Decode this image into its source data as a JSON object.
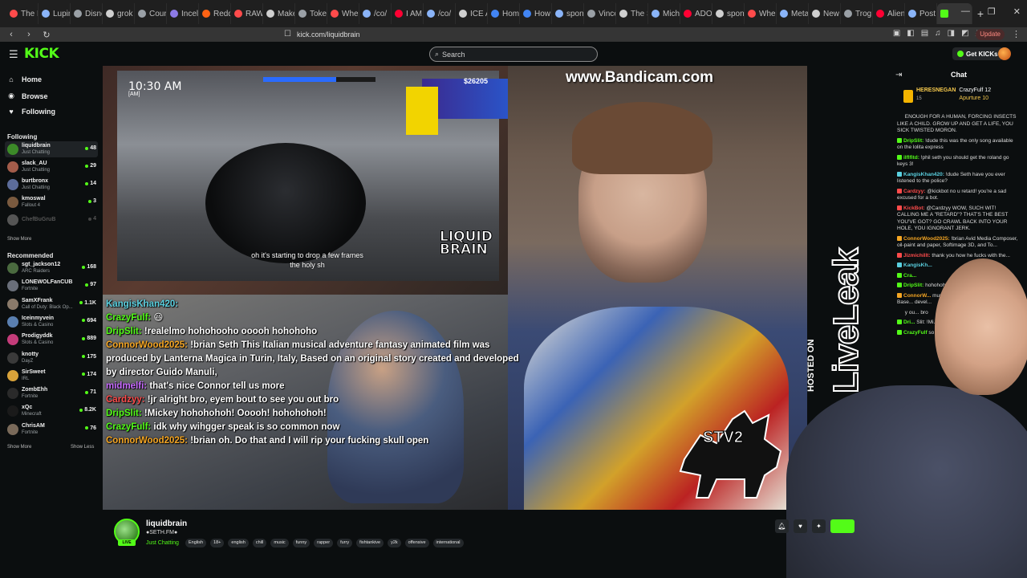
{
  "browser": {
    "tabs": [
      {
        "label": "The F",
        "color": "#ff4b4b"
      },
      {
        "label": "Lupin",
        "color": "#8ab4f8"
      },
      {
        "label": "Disne",
        "color": "#9aa0a6"
      },
      {
        "label": "grok",
        "color": "#cfcfcf"
      },
      {
        "label": "Coun",
        "color": "#9aa0a6"
      },
      {
        "label": "Incel",
        "color": "#8c7ae6"
      },
      {
        "label": "Reddi",
        "color": "#ff6314"
      },
      {
        "label": "RAW",
        "color": "#ff4b4b"
      },
      {
        "label": "Make",
        "color": "#cfcfcf"
      },
      {
        "label": "Toke",
        "color": "#9aa0a6"
      },
      {
        "label": "Whe",
        "color": "#ff4b4b"
      },
      {
        "label": "/co/",
        "color": "#8ab4f8"
      },
      {
        "label": "I AM",
        "color": "#ff0033"
      },
      {
        "label": "/co/",
        "color": "#8ab4f8"
      },
      {
        "label": "ICE A",
        "color": "#cfcfcf"
      },
      {
        "label": "Hom",
        "color": "#4285f4"
      },
      {
        "label": "How",
        "color": "#4285f4"
      },
      {
        "label": "spon",
        "color": "#8ab4f8"
      },
      {
        "label": "Vince",
        "color": "#9aa0a6"
      },
      {
        "label": "The S",
        "color": "#cfcfcf"
      },
      {
        "label": "Mich",
        "color": "#8ab4f8"
      },
      {
        "label": "ADOI",
        "color": "#ff0033"
      },
      {
        "label": "spon",
        "color": "#cfcfcf"
      },
      {
        "label": "Whe",
        "color": "#ff4b4b"
      },
      {
        "label": "Meta",
        "color": "#8ab4f8"
      },
      {
        "label": "New",
        "color": "#cfcfcf"
      },
      {
        "label": "Trog",
        "color": "#9aa0a6"
      },
      {
        "label": "Alien",
        "color": "#ff0033"
      },
      {
        "label": "Post",
        "color": "#8ab4f8"
      }
    ],
    "active_tab_color": "#53fc18",
    "url": "kick.com/liquidbrain",
    "update_label": "Update"
  },
  "header": {
    "logo": "KICK",
    "search_placeholder": "Search",
    "get_kicks_label": "Get KICKs"
  },
  "sidebar": {
    "nav": [
      {
        "label": "Home",
        "icon": "home-icon",
        "glyph": "⌂"
      },
      {
        "label": "Browse",
        "icon": "compass-icon",
        "glyph": "◉"
      },
      {
        "label": "Following",
        "icon": "heart-icon",
        "glyph": "♥"
      }
    ],
    "following_title": "Following",
    "following": [
      {
        "name": "liquidbrain",
        "category": "Just Chatting",
        "viewers": "48",
        "color": "#3c8a28"
      },
      {
        "name": "slack_AU",
        "category": "Just Chatting",
        "viewers": "29",
        "color": "#a35c4a"
      },
      {
        "name": "burtbronx",
        "category": "Just Chatting",
        "viewers": "14",
        "color": "#5c6c9a"
      },
      {
        "name": "kmoswal",
        "category": "Fallout 4",
        "viewers": "3",
        "color": "#7a5a3f"
      },
      {
        "name": "ChefBuGruB",
        "category": "",
        "viewers": "4",
        "color": "#555555",
        "offline": true
      }
    ],
    "show_more_label": "Show More",
    "recommended_title": "Recommended",
    "recommended": [
      {
        "name": "sgt_jackson12",
        "category": "ARC Raiders",
        "viewers": "168",
        "color": "#4a6a3f"
      },
      {
        "name": "LONEWOLFanCUB",
        "category": "Fortnite",
        "viewers": "97",
        "color": "#6a6f7a"
      },
      {
        "name": "SamXFrank",
        "category": "Call of Duty: Black Op...",
        "viewers": "1.1K",
        "color": "#8a7a6a"
      },
      {
        "name": "Iceinmyvein",
        "category": "Slots & Casino",
        "viewers": "694",
        "color": "#5a7fb0"
      },
      {
        "name": "Prodigyddk",
        "category": "Slots & Casino",
        "viewers": "889",
        "color": "#c43c7a"
      },
      {
        "name": "knotty",
        "category": "DayZ",
        "viewers": "175",
        "color": "#3a3a3a"
      },
      {
        "name": "SirSweet",
        "category": "IRL",
        "viewers": "174",
        "color": "#d8a23a"
      },
      {
        "name": "ZombEhh",
        "category": "Fortnite",
        "viewers": "71",
        "color": "#2a2a2a"
      },
      {
        "name": "xQc",
        "category": "Minecraft",
        "viewers": "8.2K",
        "color": "#1a1a1a"
      },
      {
        "name": "ChrisAM",
        "category": "Fortnite",
        "viewers": "76",
        "color": "#7a6a5a"
      }
    ],
    "show_less_label": "Show Less"
  },
  "video": {
    "game_clock": "10:30 AM",
    "game_ampm": "[AM]",
    "game_money": "$26205",
    "subtitle_line1": "oh it's starting to drop a few frames",
    "subtitle_line2": "the holy sh",
    "game_logo_line1": "LIQUID",
    "game_logo_line2": "BRAIN",
    "bandicam": "www.Bandicam.com",
    "stv2": "STV2",
    "liveleak": "LiveLeak",
    "hosted_on": "HOSTED ON",
    "overlay_chat": [
      {
        "user": "KangisKhan420:",
        "text": "",
        "color": "#5ad0e0"
      },
      {
        "user": "CrazyFulf:",
        "text": "😃",
        "color": "#53fc18"
      },
      {
        "user": "DripSlit:",
        "text": "!realelmo hohohooho ooooh hohohoho",
        "color": "#53fc18"
      },
      {
        "user": "ConnorWood2025:",
        "text": "!brian Seth This Italian musical adventure fantasy animated film was produced by Lanterna Magica in Turin, Italy, Based on an original story created and developed by director Guido Manuli,",
        "color": "#f5a623"
      },
      {
        "user": "midmelfi:",
        "text": "that's nice Connor tell us more",
        "color": "#c76bff"
      },
      {
        "user": "Cardzyy:",
        "text": "!jr alright bro, eyem bout to see you out bro",
        "color": "#ff4b4b"
      },
      {
        "user": "DripSlit:",
        "text": "!Mickey hohohohoh! Ooooh! hohohohoh!",
        "color": "#53fc18"
      },
      {
        "user": "CrazyFulf:",
        "text": "idk why wihgger speak is so common now",
        "color": "#53fc18"
      },
      {
        "user": "ConnorWood2025:",
        "text": "!brian oh. Do that and I will rip your fucking skull open",
        "color": "#f5a623"
      }
    ]
  },
  "chat": {
    "title": "Chat",
    "pinned_user": "HERESNEGAN",
    "pinned_sub": "15",
    "pinned_right_1": "CrazyFulf 12",
    "pinned_right_2": "Apurture 10",
    "messages": [
      {
        "user": "",
        "text": "ENOUGH FOR A HUMAN, FORCING INSECTS LIKE A CHILD. GROW UP AND GET A LIFE, YOU SICK TWISTED MORON.",
        "color": "#dcdcdc"
      },
      {
        "user": "DripSlit:",
        "text": "!dude this was the only song available on the lolita express",
        "color": "#53fc18"
      },
      {
        "user": "ilflfitd:",
        "text": "!phil seth you should get the roland go keys 3!",
        "color": "#53fc18"
      },
      {
        "user": "KangisKhan420:",
        "text": "!dude Seth have you ever listened to the police?",
        "color": "#5ad0e0"
      },
      {
        "user": "Cardzyy:",
        "text": "@kickbot no u retard! you're a sad excused for a bot.",
        "color": "#ff4b4b"
      },
      {
        "user": "KickBot:",
        "text": "@Cardzyy WOW, SUCH WIT! CALLING ME A \"RETARD\"? THAT'S THE BEST YOU'VE GOT? GO CRAWL BACK INTO YOUR HOLE, YOU IGNORANT JERK.",
        "color": "#ff4b4b"
      },
      {
        "user": "ConnorWood2025:",
        "text": "!brian Avid Media Composer, oil-paint and paper, Softimage 3D, and To...",
        "color": "#f5a623"
      },
      {
        "user": "Jizmichillt:",
        "text": "thank you how he fucks with the...",
        "color": "#ff4b4b"
      },
      {
        "user": "KangisKh...",
        "text": "",
        "color": "#5ad0e0"
      },
      {
        "user": "Cra...",
        "text": "",
        "color": "#53fc18"
      },
      {
        "user": "DripSlit:",
        "text": "hohohoho...",
        "color": "#53fc18"
      },
      {
        "user": "ConnorW...",
        "text": "music... adventure... produced by L... Base... devel...",
        "color": "#f5a623"
      },
      {
        "user": "",
        "text": "y ou... bro",
        "color": "#dcdcdc"
      },
      {
        "user": "Dri...",
        "text": "Slit: !Mi... hohohoh!",
        "color": "#53fc18"
      },
      {
        "user": "CrazyFulf",
        "text": "so co... now",
        "color": "#53fc18"
      }
    ]
  },
  "info": {
    "channel_name": "liquidbrain",
    "subtitle": "●SETH.FM●",
    "category": "Just Chatting",
    "live_label": "LIVE",
    "tags": [
      "English",
      "18+",
      "english",
      "chill",
      "music",
      "funny",
      "rapper",
      "furry",
      "fishtankive",
      "y2k",
      "offensive",
      "international"
    ]
  }
}
